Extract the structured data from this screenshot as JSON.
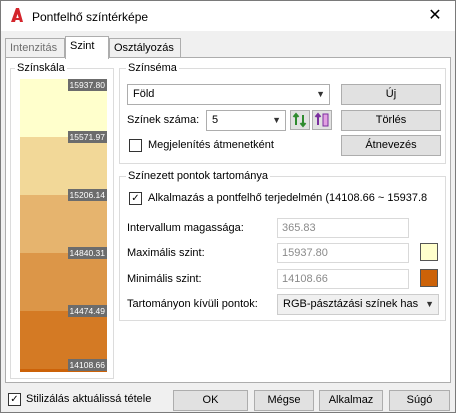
{
  "window": {
    "title": "Pontfelhő színtérképe",
    "close_glyph": "✕",
    "app_icon": "autocad-a-icon"
  },
  "tabs": [
    {
      "label": "Intenzitás",
      "active": false
    },
    {
      "label": "Szint",
      "active": true
    },
    {
      "label": "Osztályozás",
      "active": false
    }
  ],
  "color_scale": {
    "label": "Színskála",
    "bands": [
      {
        "color": "#ffffcc",
        "value": "15937.80"
      },
      {
        "color": "#f2d898",
        "value": "15571.97"
      },
      {
        "color": "#e6b46e",
        "value": "15206.14"
      },
      {
        "color": "#dc9648",
        "value": "14840.31"
      },
      {
        "color": "#d47a24",
        "value": "14474.49"
      },
      {
        "color": "#cc6208",
        "value": "14108.66"
      }
    ]
  },
  "scheme": {
    "title": "Színséma",
    "selected": "Föld",
    "new_button": "Új",
    "color_count_label": "Színek száma:",
    "color_count": "5",
    "delete_button": "Törlés",
    "gradient_checkbox": "Megjelenítés átmenetként",
    "gradient_checked": false,
    "rename_button": "Átnevezés"
  },
  "range": {
    "title": "Színezett pontok tartománya",
    "apply_checkbox": "Alkalmazás a pontfelhő terjedelmén  (14108.66 ~ 15937.8",
    "apply_checked": true,
    "interval_label": "Intervallum magassága:",
    "interval_value": "365.83",
    "max_label": "Maximális szint:",
    "max_value": "15937.80",
    "max_color": "#ffffcc",
    "min_label": "Minimális szint:",
    "min_value": "14108.66",
    "min_color": "#cc6208",
    "outside_label": "Tartományon kívüli pontok:",
    "outside_value": "RGB-pásztázási színek has"
  },
  "footer": {
    "stylize_checkbox": "Stilizálás aktuálissá tétele",
    "stylize_checked": true,
    "ok": "OK",
    "cancel": "Mégse",
    "apply": "Alkalmaz",
    "help": "Súgó"
  }
}
